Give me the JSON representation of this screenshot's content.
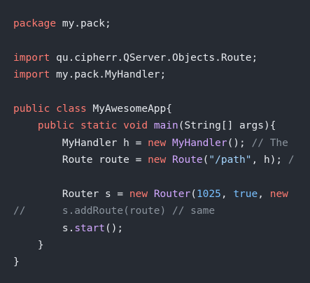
{
  "colors": {
    "background": "#262b33",
    "keyword": "#ff7b72",
    "text": "#e6e9ee",
    "function": "#d2a8ff",
    "string": "#a5d6ff",
    "number": "#79c0ff",
    "comment": "#8b949e"
  },
  "code": {
    "lines": [
      [
        {
          "t": "keyword",
          "v": "package"
        },
        {
          "t": "plain",
          "v": " my.pack;"
        }
      ],
      [],
      [
        {
          "t": "keyword",
          "v": "import"
        },
        {
          "t": "plain",
          "v": " qu.cipherr.QServer.Objects.Route;"
        }
      ],
      [
        {
          "t": "keyword",
          "v": "import"
        },
        {
          "t": "plain",
          "v": " my.pack.MyHandler;"
        }
      ],
      [],
      [
        {
          "t": "keyword",
          "v": "public"
        },
        {
          "t": "plain",
          "v": " "
        },
        {
          "t": "keyword",
          "v": "class"
        },
        {
          "t": "plain",
          "v": " MyAwesomeApp{"
        }
      ],
      [
        {
          "t": "plain",
          "v": "    "
        },
        {
          "t": "keyword",
          "v": "public"
        },
        {
          "t": "plain",
          "v": " "
        },
        {
          "t": "keyword",
          "v": "static"
        },
        {
          "t": "plain",
          "v": " "
        },
        {
          "t": "keyword",
          "v": "void"
        },
        {
          "t": "plain",
          "v": " "
        },
        {
          "t": "function",
          "v": "main"
        },
        {
          "t": "plain",
          "v": "(String[] args){"
        }
      ],
      [
        {
          "t": "plain",
          "v": "        MyHandler h = "
        },
        {
          "t": "keyword",
          "v": "new"
        },
        {
          "t": "plain",
          "v": " "
        },
        {
          "t": "function",
          "v": "MyHandler"
        },
        {
          "t": "plain",
          "v": "(); "
        },
        {
          "t": "comment",
          "v": "// The"
        }
      ],
      [
        {
          "t": "plain",
          "v": "        Route route = "
        },
        {
          "t": "keyword",
          "v": "new"
        },
        {
          "t": "plain",
          "v": " "
        },
        {
          "t": "function",
          "v": "Route"
        },
        {
          "t": "plain",
          "v": "("
        },
        {
          "t": "string",
          "v": "\"/path\""
        },
        {
          "t": "plain",
          "v": ", h); "
        },
        {
          "t": "comment",
          "v": "/"
        }
      ],
      [],
      [
        {
          "t": "plain",
          "v": "        Router s = "
        },
        {
          "t": "keyword",
          "v": "new"
        },
        {
          "t": "plain",
          "v": " "
        },
        {
          "t": "function",
          "v": "Router"
        },
        {
          "t": "plain",
          "v": "("
        },
        {
          "t": "number",
          "v": "1025"
        },
        {
          "t": "plain",
          "v": ", "
        },
        {
          "t": "constant",
          "v": "true"
        },
        {
          "t": "plain",
          "v": ", "
        },
        {
          "t": "keyword",
          "v": "new"
        }
      ],
      [
        {
          "t": "comment",
          "v": "//      s.addRoute(route) // same"
        }
      ],
      [
        {
          "t": "plain",
          "v": "        s."
        },
        {
          "t": "function",
          "v": "start"
        },
        {
          "t": "plain",
          "v": "();"
        }
      ],
      [
        {
          "t": "plain",
          "v": "    }"
        }
      ],
      [
        {
          "t": "plain",
          "v": "}"
        }
      ]
    ]
  }
}
